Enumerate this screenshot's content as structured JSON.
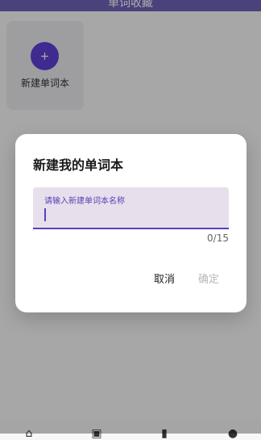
{
  "app_bar": {
    "title": "单词收藏"
  },
  "main": {
    "new_book_card": {
      "icon_label": "+",
      "label": "新建单词本"
    }
  },
  "dialog": {
    "title": "新建我的单词本",
    "input": {
      "label": "请输入新建单词本名称",
      "value": ""
    },
    "counter": "0/15",
    "actions": {
      "cancel": "取消",
      "confirm": "确定"
    }
  },
  "bottom_nav": {
    "items": [
      {
        "icon": "home-icon"
      },
      {
        "icon": "briefcase-icon"
      },
      {
        "icon": "book-icon"
      },
      {
        "icon": "person-icon"
      }
    ]
  },
  "colors": {
    "primary": "#6e62b6",
    "accent": "#5b3fb7",
    "dialog_bg": "#ffffff",
    "field_bg": "#e7e0ec",
    "scrim": "rgba(0,0,0,0.32)"
  }
}
